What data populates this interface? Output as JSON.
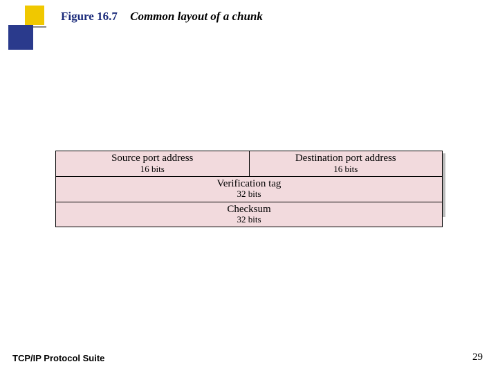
{
  "title": {
    "figure": "Figure 16.7",
    "description": "Common layout of a chunk"
  },
  "header_fields": {
    "row1": {
      "left": {
        "label": "Source port address",
        "bits": "16 bits"
      },
      "right": {
        "label": "Destination port address",
        "bits": "16 bits"
      }
    },
    "row2": {
      "label": "Verification tag",
      "bits": "32 bits"
    },
    "row3": {
      "label": "Checksum",
      "bits": "32 bits"
    }
  },
  "footer": {
    "left": "TCP/IP Protocol Suite",
    "page": "29"
  }
}
